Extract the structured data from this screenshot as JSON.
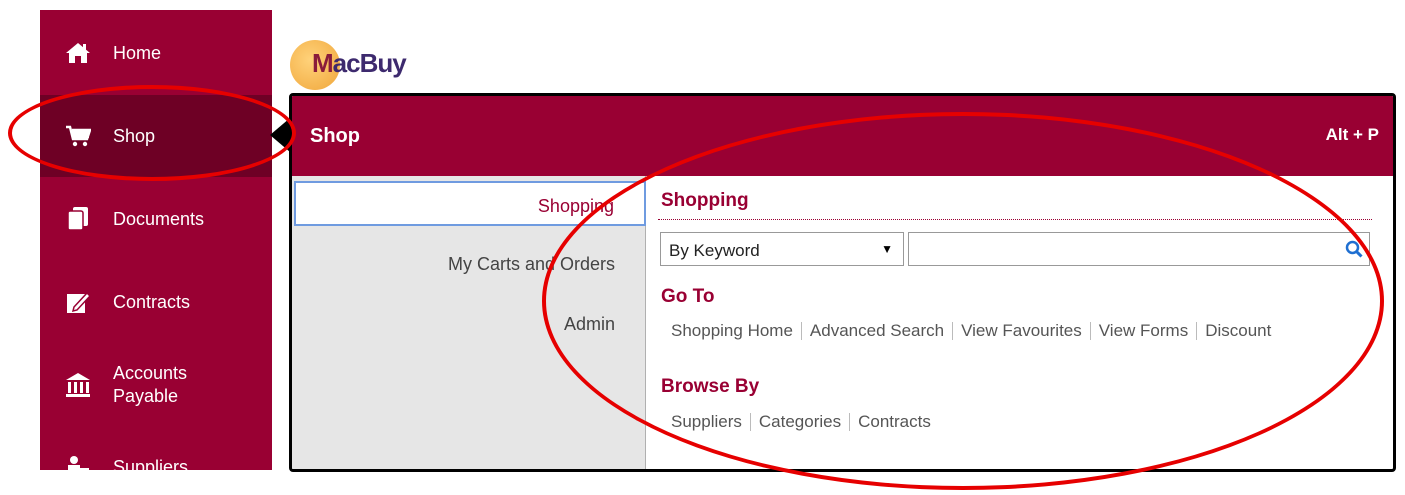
{
  "logo": {
    "text_m": "M",
    "text_rest": "acBuy"
  },
  "nav": {
    "items": [
      {
        "label": "Home",
        "icon": "home-icon"
      },
      {
        "label": "Shop",
        "icon": "cart-icon"
      },
      {
        "label": "Documents",
        "icon": "documents-icon"
      },
      {
        "label": "Contracts",
        "icon": "contract-pen-icon"
      },
      {
        "label": "Accounts\nPayable",
        "icon": "bank-icon"
      },
      {
        "label": "Suppliers",
        "icon": "suppliers-icon"
      }
    ]
  },
  "panel": {
    "title": "Shop",
    "shortcut": "Alt + P",
    "subnav": [
      "Shopping",
      "My Carts and Orders",
      "Admin"
    ],
    "shopping_title": "Shopping",
    "search": {
      "type_value": "By Keyword",
      "placeholder": ""
    },
    "goto_title": "Go To",
    "goto_links": [
      "Shopping Home",
      "Advanced Search",
      "View Favourites",
      "View Forms",
      "Discount"
    ],
    "browse_title": "Browse By",
    "browse_links": [
      "Suppliers",
      "Categories",
      "Contracts"
    ]
  },
  "colors": {
    "brand": "#990033",
    "brand_dark": "#6e0025",
    "annotation": "#e60000",
    "focus": "#6f9be0"
  }
}
